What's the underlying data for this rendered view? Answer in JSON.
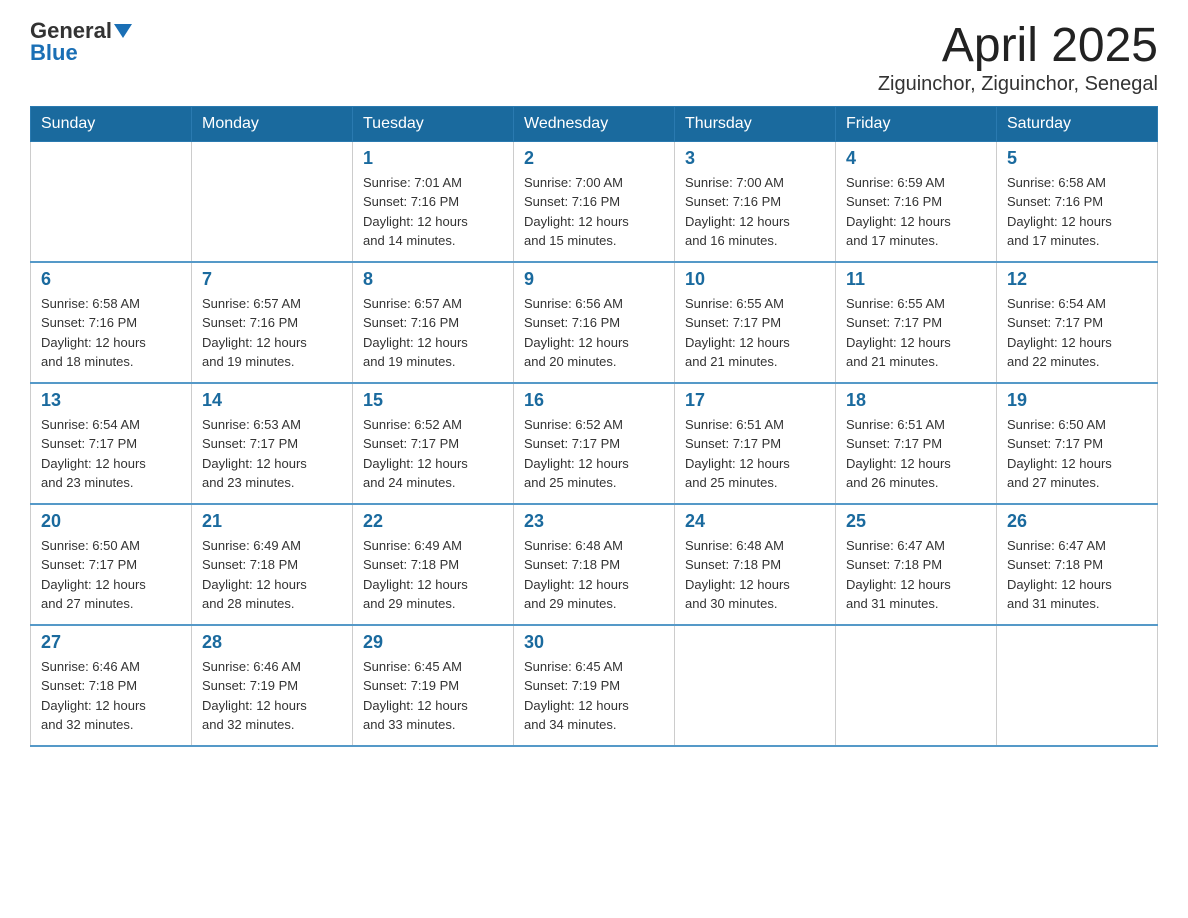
{
  "logo": {
    "text_general": "General",
    "text_blue": "Blue",
    "arrow": "▼"
  },
  "title": "April 2025",
  "subtitle": "Ziguinchor, Ziguinchor, Senegal",
  "weekdays": [
    "Sunday",
    "Monday",
    "Tuesday",
    "Wednesday",
    "Thursday",
    "Friday",
    "Saturday"
  ],
  "weeks": [
    [
      {
        "day": "",
        "info": ""
      },
      {
        "day": "",
        "info": ""
      },
      {
        "day": "1",
        "info": "Sunrise: 7:01 AM\nSunset: 7:16 PM\nDaylight: 12 hours\nand 14 minutes."
      },
      {
        "day": "2",
        "info": "Sunrise: 7:00 AM\nSunset: 7:16 PM\nDaylight: 12 hours\nand 15 minutes."
      },
      {
        "day": "3",
        "info": "Sunrise: 7:00 AM\nSunset: 7:16 PM\nDaylight: 12 hours\nand 16 minutes."
      },
      {
        "day": "4",
        "info": "Sunrise: 6:59 AM\nSunset: 7:16 PM\nDaylight: 12 hours\nand 17 minutes."
      },
      {
        "day": "5",
        "info": "Sunrise: 6:58 AM\nSunset: 7:16 PM\nDaylight: 12 hours\nand 17 minutes."
      }
    ],
    [
      {
        "day": "6",
        "info": "Sunrise: 6:58 AM\nSunset: 7:16 PM\nDaylight: 12 hours\nand 18 minutes."
      },
      {
        "day": "7",
        "info": "Sunrise: 6:57 AM\nSunset: 7:16 PM\nDaylight: 12 hours\nand 19 minutes."
      },
      {
        "day": "8",
        "info": "Sunrise: 6:57 AM\nSunset: 7:16 PM\nDaylight: 12 hours\nand 19 minutes."
      },
      {
        "day": "9",
        "info": "Sunrise: 6:56 AM\nSunset: 7:16 PM\nDaylight: 12 hours\nand 20 minutes."
      },
      {
        "day": "10",
        "info": "Sunrise: 6:55 AM\nSunset: 7:17 PM\nDaylight: 12 hours\nand 21 minutes."
      },
      {
        "day": "11",
        "info": "Sunrise: 6:55 AM\nSunset: 7:17 PM\nDaylight: 12 hours\nand 21 minutes."
      },
      {
        "day": "12",
        "info": "Sunrise: 6:54 AM\nSunset: 7:17 PM\nDaylight: 12 hours\nand 22 minutes."
      }
    ],
    [
      {
        "day": "13",
        "info": "Sunrise: 6:54 AM\nSunset: 7:17 PM\nDaylight: 12 hours\nand 23 minutes."
      },
      {
        "day": "14",
        "info": "Sunrise: 6:53 AM\nSunset: 7:17 PM\nDaylight: 12 hours\nand 23 minutes."
      },
      {
        "day": "15",
        "info": "Sunrise: 6:52 AM\nSunset: 7:17 PM\nDaylight: 12 hours\nand 24 minutes."
      },
      {
        "day": "16",
        "info": "Sunrise: 6:52 AM\nSunset: 7:17 PM\nDaylight: 12 hours\nand 25 minutes."
      },
      {
        "day": "17",
        "info": "Sunrise: 6:51 AM\nSunset: 7:17 PM\nDaylight: 12 hours\nand 25 minutes."
      },
      {
        "day": "18",
        "info": "Sunrise: 6:51 AM\nSunset: 7:17 PM\nDaylight: 12 hours\nand 26 minutes."
      },
      {
        "day": "19",
        "info": "Sunrise: 6:50 AM\nSunset: 7:17 PM\nDaylight: 12 hours\nand 27 minutes."
      }
    ],
    [
      {
        "day": "20",
        "info": "Sunrise: 6:50 AM\nSunset: 7:17 PM\nDaylight: 12 hours\nand 27 minutes."
      },
      {
        "day": "21",
        "info": "Sunrise: 6:49 AM\nSunset: 7:18 PM\nDaylight: 12 hours\nand 28 minutes."
      },
      {
        "day": "22",
        "info": "Sunrise: 6:49 AM\nSunset: 7:18 PM\nDaylight: 12 hours\nand 29 minutes."
      },
      {
        "day": "23",
        "info": "Sunrise: 6:48 AM\nSunset: 7:18 PM\nDaylight: 12 hours\nand 29 minutes."
      },
      {
        "day": "24",
        "info": "Sunrise: 6:48 AM\nSunset: 7:18 PM\nDaylight: 12 hours\nand 30 minutes."
      },
      {
        "day": "25",
        "info": "Sunrise: 6:47 AM\nSunset: 7:18 PM\nDaylight: 12 hours\nand 31 minutes."
      },
      {
        "day": "26",
        "info": "Sunrise: 6:47 AM\nSunset: 7:18 PM\nDaylight: 12 hours\nand 31 minutes."
      }
    ],
    [
      {
        "day": "27",
        "info": "Sunrise: 6:46 AM\nSunset: 7:18 PM\nDaylight: 12 hours\nand 32 minutes."
      },
      {
        "day": "28",
        "info": "Sunrise: 6:46 AM\nSunset: 7:19 PM\nDaylight: 12 hours\nand 32 minutes."
      },
      {
        "day": "29",
        "info": "Sunrise: 6:45 AM\nSunset: 7:19 PM\nDaylight: 12 hours\nand 33 minutes."
      },
      {
        "day": "30",
        "info": "Sunrise: 6:45 AM\nSunset: 7:19 PM\nDaylight: 12 hours\nand 34 minutes."
      },
      {
        "day": "",
        "info": ""
      },
      {
        "day": "",
        "info": ""
      },
      {
        "day": "",
        "info": ""
      }
    ]
  ]
}
